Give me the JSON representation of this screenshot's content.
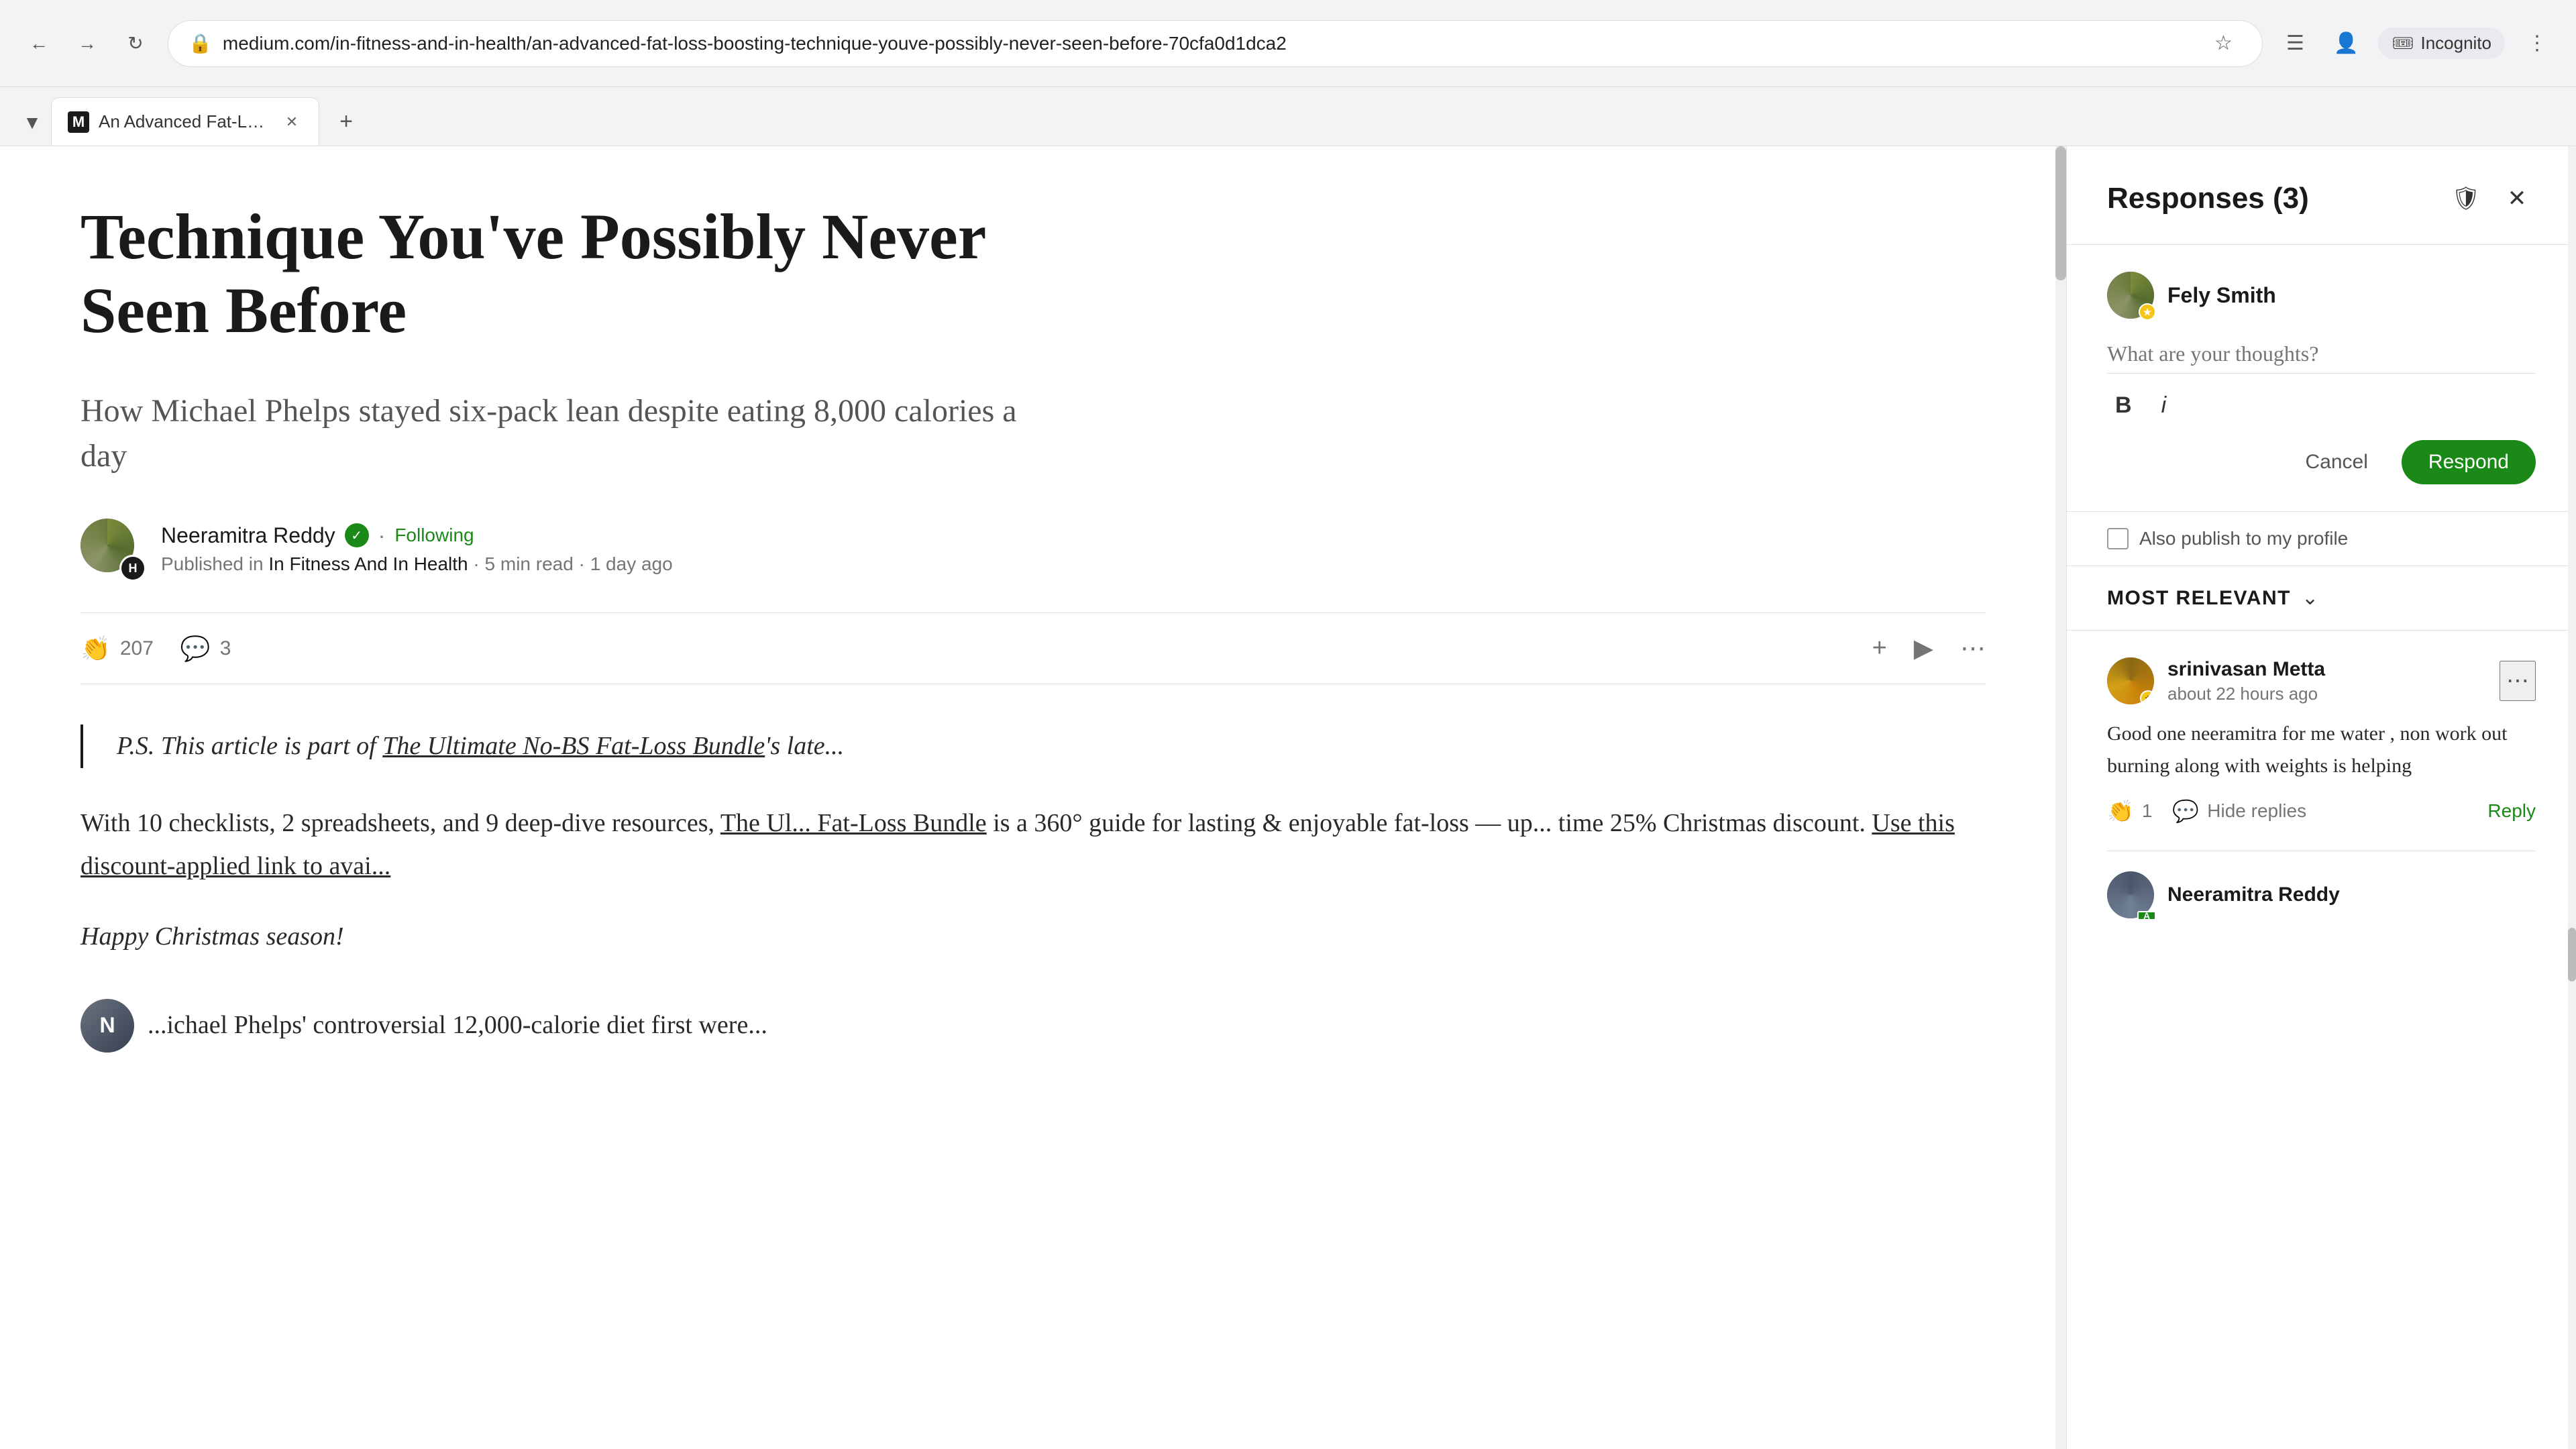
{
  "browser": {
    "url": "medium.com/in-fitness-and-in-health/an-advanced-fat-loss-boosting-technique-youve-possibly-never-seen-before-70cfa0d1dca2",
    "tab_title": "An Advanced Fat-Loss-Boosting...",
    "incognito_label": "Incognito"
  },
  "article": {
    "title": "Technique You've Possibly Never Seen Before",
    "subtitle": "How Michael Phelps stayed six-pack lean despite eating 8,000 calories a day",
    "author_name": "Neeramitra Reddy",
    "following_label": "Following",
    "published_in": "In Fitness And In Health",
    "read_time": "5 min read",
    "time_ago": "1 day ago",
    "clap_count": "207",
    "comment_count": "3",
    "blockquote_text": "P.S. This article is part of The Ultimate No-BS Fat-Loss Bundle's late...",
    "body_text": "With 10 checklists, 2 spreadsheets, and 9 deep-dive resources, The Ul... Fat-Loss Bundle is a 360° guide for lasting & enjoyable fat-loss — up... time 25% Christmas discount. Use this discount-applied link to avai...",
    "happy_christmas": "Happy Christmas season!",
    "bottom_text": "...ichael Phelps' controversial 12,000-calorie diet first were..."
  },
  "responses_panel": {
    "title": "Responses",
    "count": 3,
    "full_title": "Responses (3)",
    "composer": {
      "user_name": "Fely Smith",
      "placeholder": "What are your thoughts?",
      "bold_label": "B",
      "italic_label": "i",
      "cancel_label": "Cancel",
      "respond_label": "Respond"
    },
    "publish_to_profile": "Also publish to my profile",
    "filter_label": "MOST RELEVANT",
    "comments": [
      {
        "author": "srinivasan Metta",
        "time": "about 22 hours ago",
        "text": "Good one neeramitra for me water , non work out burning along with weights is helping",
        "claps": "1",
        "hide_replies": "Hide replies",
        "reply_label": "Reply"
      },
      {
        "author": "Neeramitra Reddy",
        "time": "",
        "text": "",
        "badge": "AUTHOR"
      }
    ]
  }
}
